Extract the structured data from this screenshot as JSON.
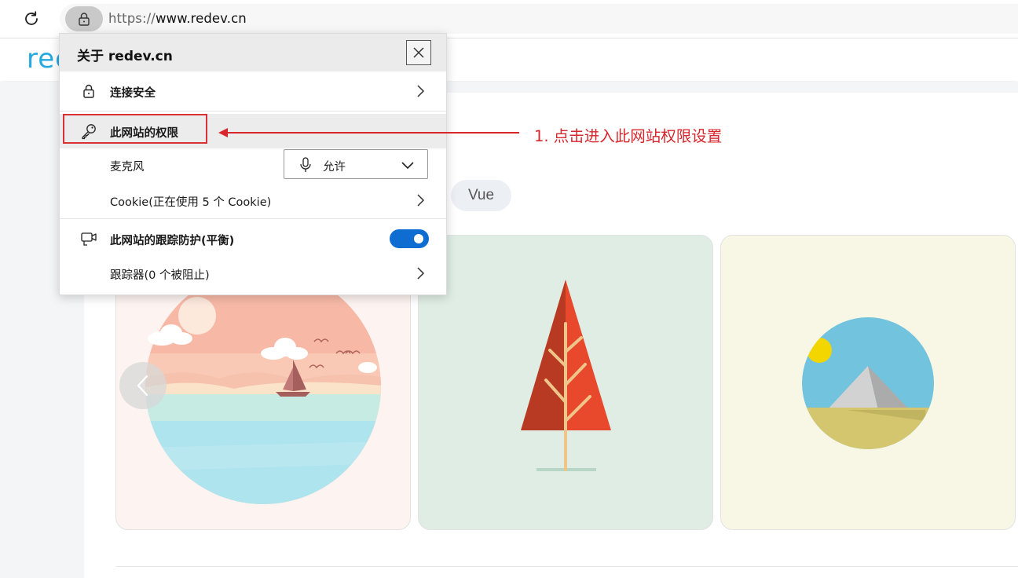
{
  "browser": {
    "url_scheme": "https://",
    "url_host": "www.redev.cn",
    "reload_icon": "reload-icon",
    "lock_icon": "lock-icon"
  },
  "site": {
    "logo_text": "rec",
    "tags": [
      "Vue"
    ],
    "brand_color": "#25a9e0"
  },
  "popup": {
    "title": "关于 redev.cn",
    "connection": {
      "label": "连接安全",
      "icon": "lock-icon"
    },
    "permissions": {
      "label": "此网站的权限",
      "icon": "key-icon"
    },
    "microphone": {
      "label": "麦克风",
      "value": "允许",
      "icon": "microphone-icon"
    },
    "cookies": {
      "label": "Cookie(正在使用 5 个 Cookie)"
    },
    "tracking": {
      "label": "此网站的跟踪防护(平衡)",
      "icon": "tracking-camera-icon",
      "enabled": true,
      "toggle_color": "#0f6cd0"
    },
    "trackers": {
      "label": "跟踪器(0 个被阻止)"
    }
  },
  "annotation": {
    "text": "1. 点击进入此网站权限设置",
    "color": "#d8262d"
  }
}
